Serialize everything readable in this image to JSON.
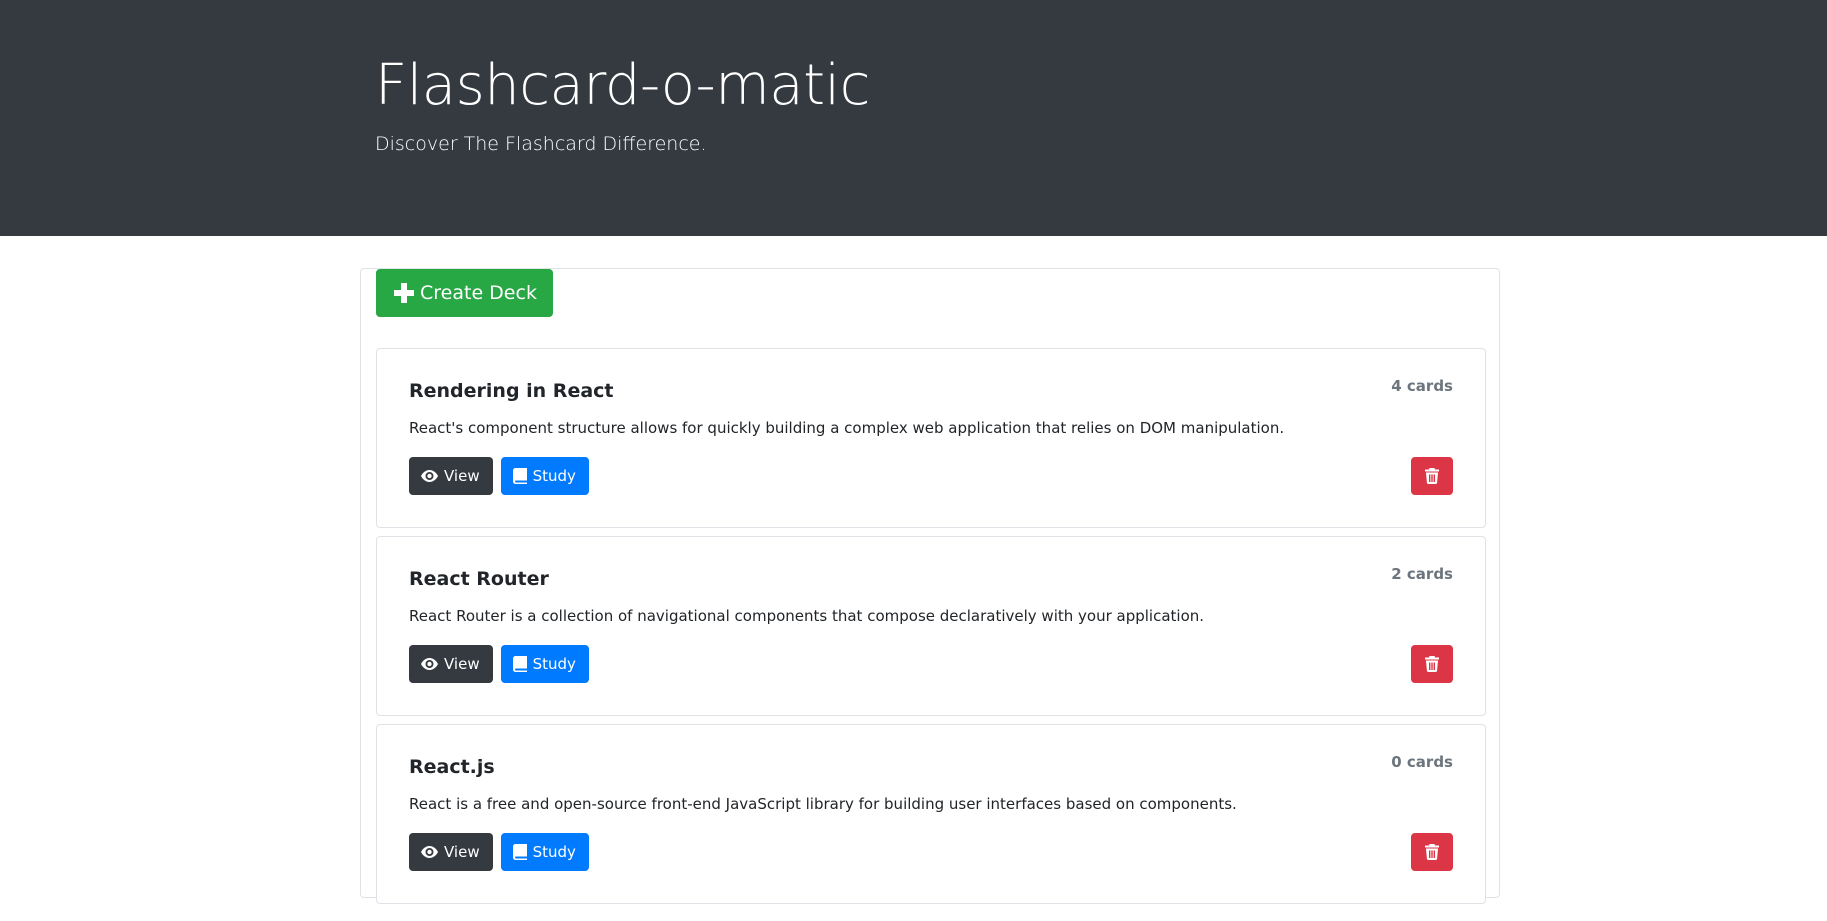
{
  "header": {
    "title": "Flashcard-o-matic",
    "tagline": "Discover The Flashcard Difference."
  },
  "actions": {
    "create_deck_label": "Create Deck"
  },
  "decks": [
    {
      "name": "Rendering in React",
      "card_count": "4 cards",
      "description": "React's component structure allows for quickly building a complex web application that relies on DOM manipulation.",
      "view_label": "View",
      "study_label": "Study"
    },
    {
      "name": "React Router",
      "card_count": "2 cards",
      "description": "React Router is a collection of navigational components that compose declaratively with your application.",
      "view_label": "View",
      "study_label": "Study"
    },
    {
      "name": "React.js",
      "card_count": "0 cards",
      "description": "React is a free and open-source front-end JavaScript library for building user interfaces based on components.",
      "view_label": "View",
      "study_label": "Study"
    }
  ],
  "icons": {
    "create": "plus-icon",
    "view": "eye-icon",
    "study": "book-icon",
    "delete": "trash-icon"
  },
  "colors": {
    "header_bg": "#343a40",
    "success": "#28a745",
    "primary": "#007bff",
    "dark": "#343a40",
    "danger": "#dc3545",
    "muted": "#6c757d"
  }
}
